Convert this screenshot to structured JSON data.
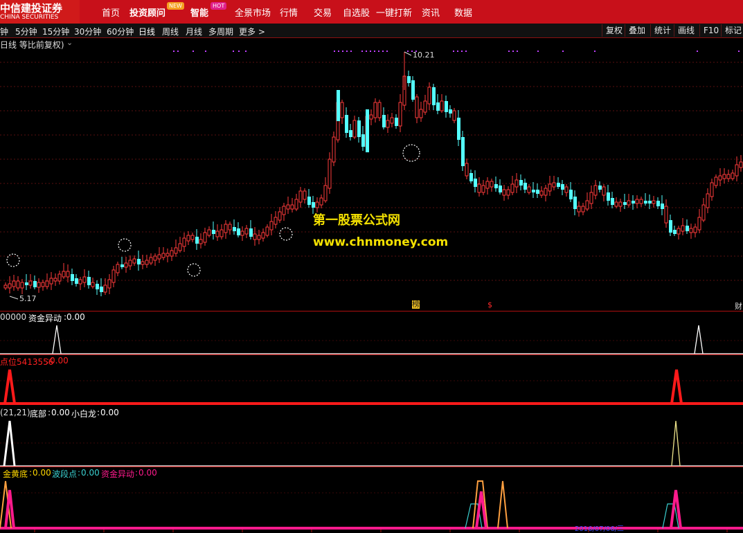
{
  "brand": {
    "name_cn": "中信建投证券",
    "name_en": "CHINA SECURITIES"
  },
  "nav": {
    "items": [
      {
        "label": "首页"
      },
      {
        "label": "投资顾问",
        "badge": "NEW"
      },
      {
        "label": "智能",
        "badge": "HOT"
      },
      {
        "label": "全景市场"
      },
      {
        "label": "行情"
      },
      {
        "label": "交易"
      },
      {
        "label": "自选股"
      },
      {
        "label": "一键打新"
      },
      {
        "label": "资讯"
      },
      {
        "label": "数据"
      }
    ]
  },
  "toolbar": {
    "periods": [
      "钟",
      "5分钟",
      "15分钟",
      "30分钟",
      "60分钟",
      "日线",
      "周线",
      "月线",
      "多周期",
      "更多 >"
    ],
    "active_period": "日线",
    "right_buttons": [
      "复权",
      "叠加",
      "统计",
      "画线",
      "F10",
      "标记"
    ]
  },
  "main_panel": {
    "title": "日线 等比前复权)",
    "high_label": "10.21",
    "low_label": "5.17",
    "markers": [
      "榜",
      "$",
      "财"
    ],
    "watermark_cn": "第一股票公式网",
    "watermark_url": "www.chnmoney.com",
    "colors": {
      "up": "#ff3b3b",
      "down": "#54ffff",
      "grid": "#5a0f0f"
    }
  },
  "indicator1": {
    "prefix": "00000",
    "name": "资金异动",
    "value": "0.00",
    "color": "#ffffff"
  },
  "indicator2": {
    "name": "点位5413556",
    "value": "0.00",
    "color": "#ff1a1a"
  },
  "indicator3": {
    "prefix": "(21,21)",
    "items": [
      {
        "name": "底部",
        "value": "0.00",
        "color": "#ffffff"
      },
      {
        "name": "小白龙",
        "value": "0.00",
        "color": "#ffffff"
      }
    ]
  },
  "indicator4": {
    "items": [
      {
        "name": "金黄底",
        "value": "0.00",
        "color": "#ffd700"
      },
      {
        "name": "波段点",
        "value": "0.00",
        "color": "#3ad0d0"
      },
      {
        "name": "资金异动",
        "value": "0.00",
        "color": "#ff1a8c"
      }
    ]
  },
  "bottom_date": "2016/07/06/三"
}
